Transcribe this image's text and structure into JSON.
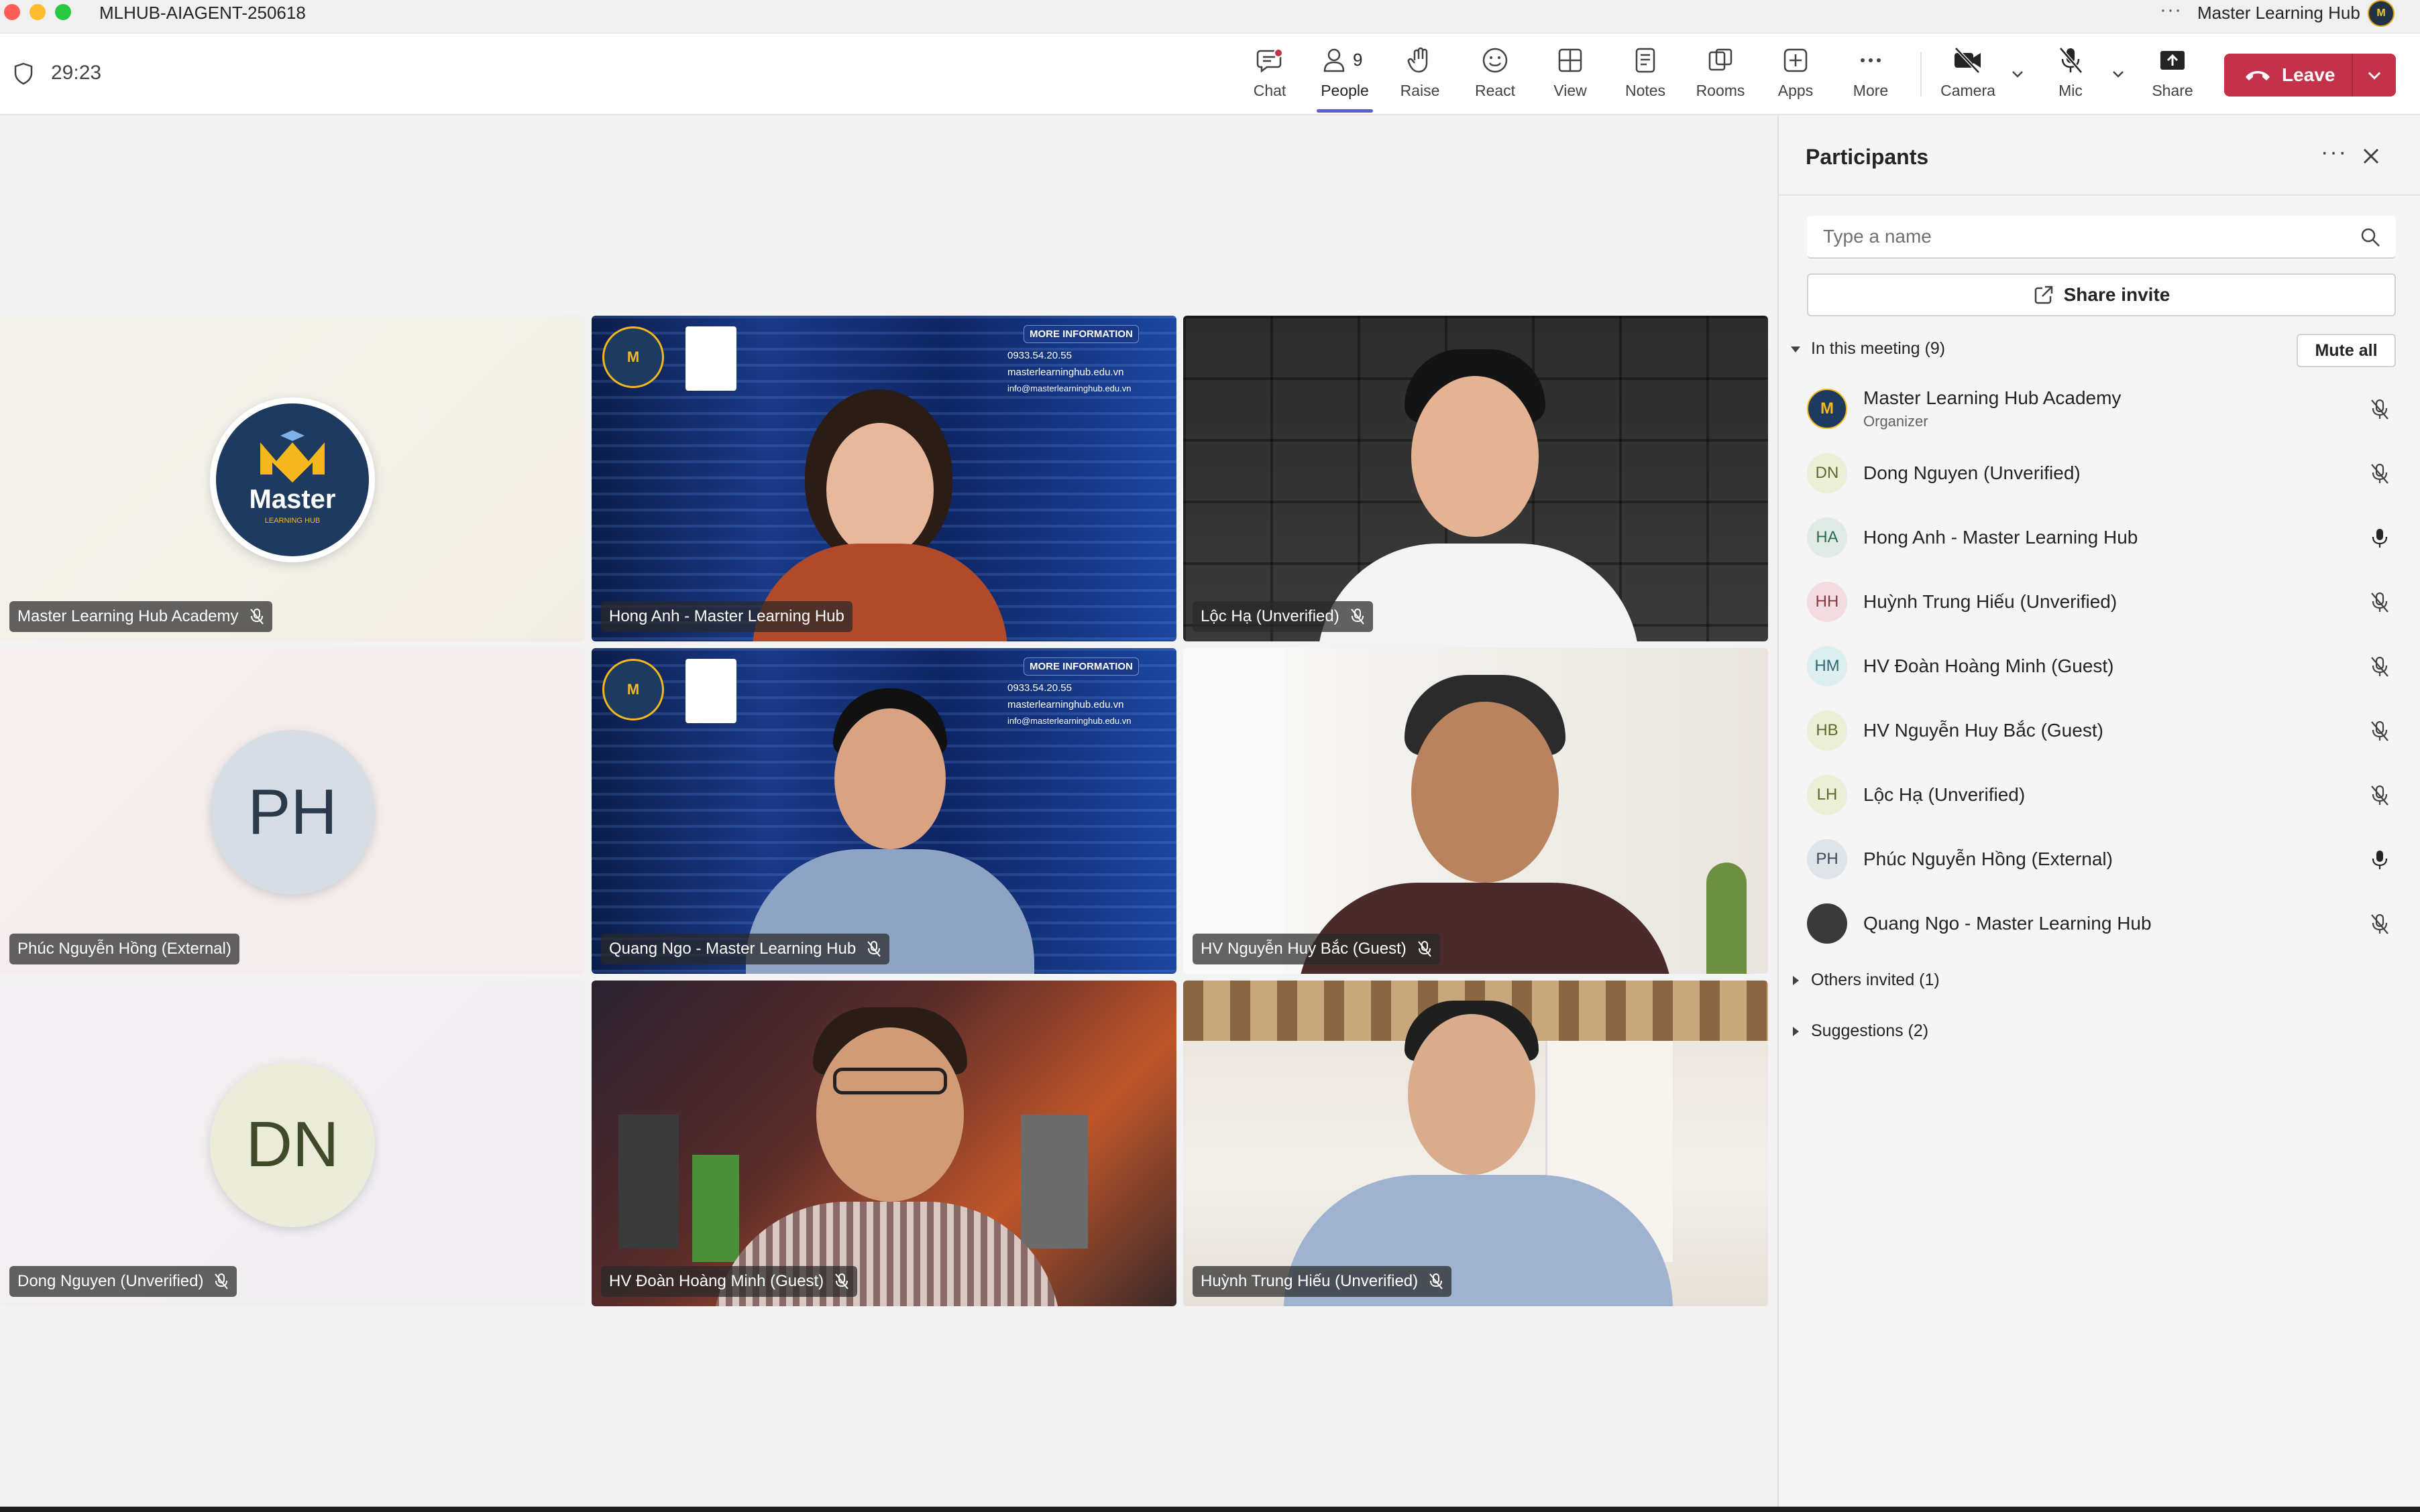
{
  "window": {
    "title": "MLHUB-AIAGENT-250618",
    "account_name": "Master Learning Hub",
    "more_icon": "ellipsis-icon"
  },
  "toolbar": {
    "timer": "29:23",
    "buttons": {
      "chat": "Chat",
      "people": "People",
      "people_count": "9",
      "raise": "Raise",
      "react": "React",
      "view": "View",
      "notes": "Notes",
      "rooms": "Rooms",
      "apps": "Apps",
      "more": "More",
      "camera": "Camera",
      "mic": "Mic",
      "share": "Share",
      "leave": "Leave"
    },
    "accent_color": "#5b5fc7",
    "leave_color": "#c4314b"
  },
  "video_tiles": [
    {
      "name": "Master Learning Hub Academy",
      "kind": "logo",
      "muted": true
    },
    {
      "name": "Hong Anh - Master Learning Hub",
      "kind": "video",
      "muted": false
    },
    {
      "name": "Lộc Hạ (Unverified)",
      "kind": "video",
      "muted": true
    },
    {
      "name": "Phúc Nguyễn Hồng (External)",
      "kind": "initials",
      "initials": "PH",
      "muted": false
    },
    {
      "name": "Quang Ngo - Master Learning Hub",
      "kind": "video",
      "muted": true
    },
    {
      "name": "HV Nguyễn Huy Bắc (Guest)",
      "kind": "video",
      "muted": true
    },
    {
      "name": "Dong Nguyen (Unverified)",
      "kind": "initials",
      "initials": "DN",
      "muted": true
    },
    {
      "name": "HV Đoàn Hoàng Minh (Guest)",
      "kind": "video",
      "muted": true
    },
    {
      "name": "Huỳnh Trung Hiếu (Unverified)",
      "kind": "video",
      "muted": true
    }
  ],
  "video_overlay": {
    "logo_text": "Master",
    "logo_sub": "LEARNING HUB",
    "info_title": "MORE INFORMATION",
    "info_phone": "0933.54.20.55",
    "info_site": "masterlearninghub.edu.vn",
    "info_email": "info@masterlearninghub.edu.vn"
  },
  "participants_panel": {
    "title": "Participants",
    "search_placeholder": "Type a name",
    "share_invite": "Share invite",
    "in_meeting_label": "In this meeting (9)",
    "mute_all": "Mute all",
    "others_invited": "Others invited (1)",
    "suggestions": "Suggestions (2)",
    "participants": [
      {
        "name": "Master Learning Hub Academy",
        "role": "Organizer",
        "initials": "M",
        "mic": "muted"
      },
      {
        "name": "Dong Nguyen (Unverified)",
        "initials": "DN",
        "mic": "muted"
      },
      {
        "name": "Hong Anh - Master Learning Hub",
        "initials": "HA",
        "mic": "on"
      },
      {
        "name": "Huỳnh Trung Hiếu (Unverified)",
        "initials": "HH",
        "mic": "muted"
      },
      {
        "name": "HV Đoàn Hoàng Minh (Guest)",
        "initials": "HM",
        "mic": "muted"
      },
      {
        "name": "HV Nguyễn Huy Bắc (Guest)",
        "initials": "HB",
        "mic": "muted"
      },
      {
        "name": "Lộc Hạ (Unverified)",
        "initials": "LH",
        "mic": "muted"
      },
      {
        "name": "Phúc Nguyễn Hồng (External)",
        "initials": "PH",
        "mic": "on"
      },
      {
        "name": "Quang Ngo - Master Learning Hub",
        "initials": "",
        "mic": "muted"
      }
    ]
  }
}
